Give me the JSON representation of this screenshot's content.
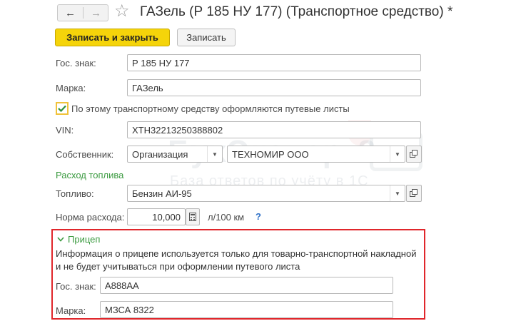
{
  "header": {
    "title": "ГАЗель (Р 185 НУ 177) (Транспортное средство) *"
  },
  "toolbar": {
    "save_close_label": "Записать и закрыть",
    "save_label": "Записать"
  },
  "form": {
    "reg_number": {
      "label": "Гос. знак:",
      "value": "Р 185 НУ 177"
    },
    "brand": {
      "label": "Марка:",
      "value": "ГАЗель"
    },
    "waybill_checkbox": {
      "label": "По этому транспортному средству оформляются путевые листы",
      "checked": true
    },
    "vin": {
      "label": "VIN:",
      "value": "XTH32213250388802"
    },
    "owner": {
      "label": "Собственник:",
      "type_value": "Организация",
      "value": "ТЕХНОМИР ООО"
    },
    "fuel_section_title": "Расход топлива",
    "fuel": {
      "label": "Топливо:",
      "value": "Бензин АИ-95"
    },
    "consumption": {
      "label": "Норма расхода:",
      "value": "10,000",
      "unit": "л/100 км",
      "help": "?"
    }
  },
  "trailer": {
    "section_title": "Прицеп",
    "info_line1": "Информация о прицепе используется только для товарно-транспортной накладной",
    "info_line2": "и не будет учитываться при оформлении путевого листа",
    "reg_number": {
      "label": "Гос. знак:",
      "value": "А888АА"
    },
    "brand": {
      "label": "Марка:",
      "value": "МЗСА 8322"
    }
  },
  "watermark": {
    "main": "БухЭксперт8",
    "sub": "База ответов по учёту в 1С"
  },
  "colors": {
    "primary_button": "#f5d40a",
    "section_title": "#3a9a3f",
    "highlight_border": "#e0262b",
    "help": "#2d6fc7"
  }
}
